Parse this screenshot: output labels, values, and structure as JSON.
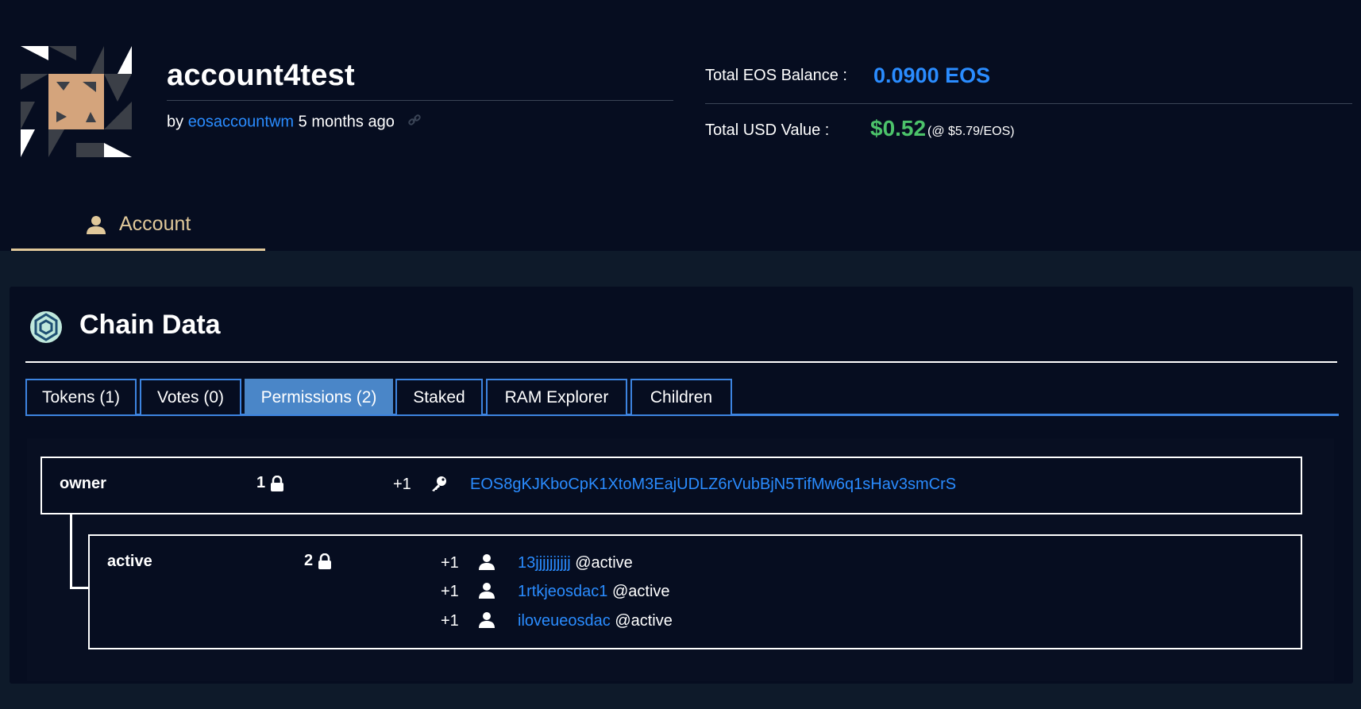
{
  "account": {
    "name": "account4test",
    "by_prefix": "by",
    "creator": "eosaccountwm",
    "age": "5 months ago"
  },
  "balances": {
    "eos_label": "Total EOS Balance :",
    "eos_value": "0.0900 EOS",
    "usd_label": "Total USD Value :",
    "usd_value": "$0.52",
    "usd_rate": "(@ $5.79/EOS)"
  },
  "nav": {
    "account_tab": "Account"
  },
  "chain": {
    "title": "Chain Data",
    "tabs": [
      {
        "label": "Tokens (1)"
      },
      {
        "label": "Votes (0)"
      },
      {
        "label": "Permissions (2)"
      },
      {
        "label": "Staked"
      },
      {
        "label": "RAM Explorer"
      },
      {
        "label": "Children"
      }
    ],
    "active_tab": "Permissions (2)"
  },
  "permissions": {
    "owner": {
      "name": "owner",
      "threshold": "1",
      "keys": [
        {
          "weight": "+1",
          "key": "EOS8gKJKboCpK1XtoM3EajUDLZ6rVubBjN5TifMw6q1sHav3smCrS"
        }
      ]
    },
    "active": {
      "name": "active",
      "threshold": "2",
      "accounts": [
        {
          "weight": "+1",
          "account": "13jjjjjjjjjj",
          "permission": "@active"
        },
        {
          "weight": "+1",
          "account": "1rtkjeosdac1",
          "permission": "@active"
        },
        {
          "weight": "+1",
          "account": "iloveueosdac",
          "permission": "@active"
        }
      ]
    }
  },
  "colors": {
    "link": "#2a8cff",
    "usd": "#4cc36a",
    "account_tab": "#e0c89a",
    "tab_active": "#4a86c8"
  }
}
